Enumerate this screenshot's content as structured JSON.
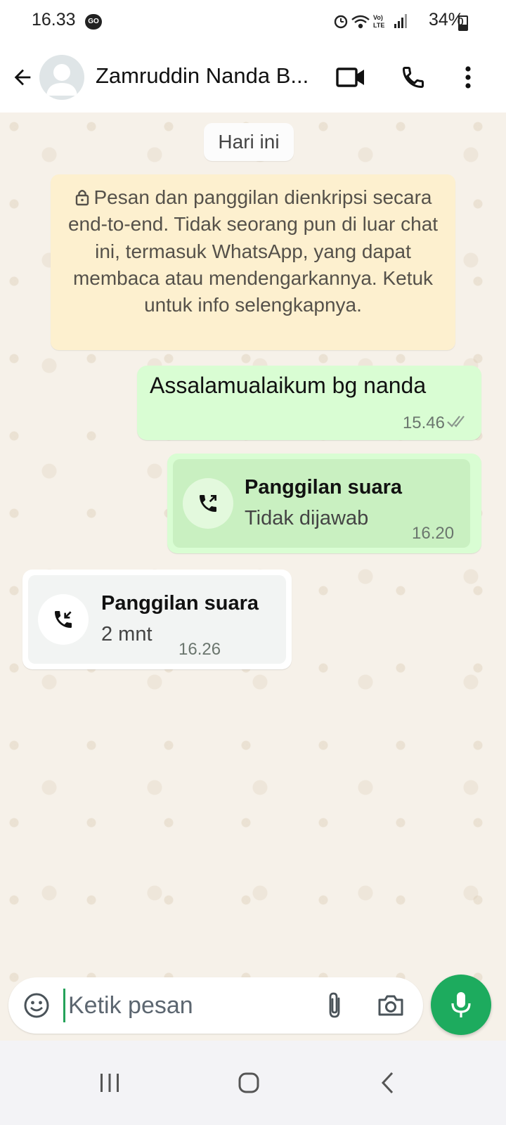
{
  "status_bar": {
    "time": "16.33",
    "carrier_badge": "GO",
    "battery": "34%",
    "icons": [
      "alarm-icon",
      "wifi-icon",
      "volte-icon",
      "signal-icon",
      "battery-icon"
    ]
  },
  "header": {
    "contact_name": "Zamruddin Nanda B...",
    "icons": [
      "back-arrow-icon",
      "avatar",
      "video-call-icon",
      "phone-icon",
      "more-options-icon"
    ]
  },
  "chat": {
    "date_chip": "Hari ini",
    "encryption_notice": "Pesan dan panggilan dienkripsi secara end-to-end. Tidak seorang pun di luar chat ini, termasuk WhatsApp, yang dapat membaca atau mendengarkannya. Ketuk untuk info selengkapnya.",
    "messages": [
      {
        "direction": "outgoing",
        "type": "text",
        "text": "Assalamualaikum bg nanda",
        "time": "15.46",
        "status": "read-ticks"
      },
      {
        "direction": "outgoing",
        "type": "call",
        "title": "Panggilan suara",
        "subtitle": "Tidak dijawab",
        "time": "16.20"
      },
      {
        "direction": "incoming",
        "type": "call",
        "title": "Panggilan suara",
        "subtitle": "2 mnt",
        "time": "16.26"
      }
    ]
  },
  "composer": {
    "placeholder": "Ketik pesan",
    "icons": [
      "emoji-icon",
      "attach-icon",
      "camera-icon",
      "mic-icon"
    ]
  },
  "colors": {
    "outgoing_bubble": "#d9fdd3",
    "mic_button": "#1dab5e",
    "notice_bg": "#fdf0cf"
  },
  "nav_bar": {
    "buttons": [
      "recents",
      "home",
      "back"
    ]
  }
}
